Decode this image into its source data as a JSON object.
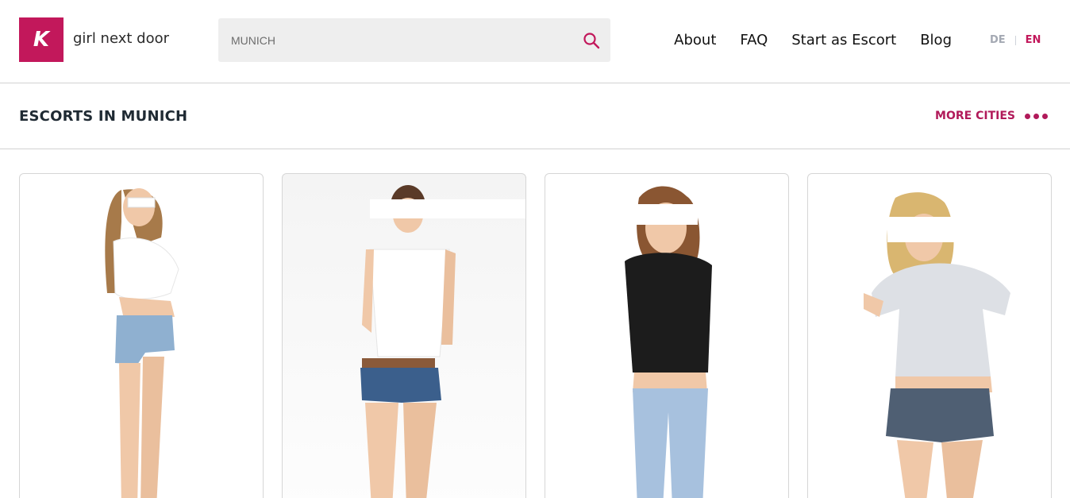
{
  "header": {
    "logo_letter": "K",
    "brand": "girl next door",
    "search_value": "MUNICH",
    "nav": [
      "About",
      "FAQ",
      "Start as Escort",
      "Blog"
    ],
    "lang": {
      "de": "DE",
      "en": "EN",
      "active": "EN"
    }
  },
  "section": {
    "title": "ESCORTS IN MUNICH",
    "more_cities": "MORE CITIES"
  },
  "colors": {
    "accent": "#c2185b",
    "accent_text": "#b11a5a",
    "search_bg": "#eeeeee",
    "divider": "#d2d2d2"
  },
  "icons": {
    "search": "search-icon",
    "more": "dots-icon"
  },
  "cards": [
    {
      "image": "model photo",
      "tee": "#ffffff",
      "bottom": "#8fb0d0"
    },
    {
      "image": "model photo",
      "tee": "#ffffff",
      "bottom": "#3b5f8c"
    },
    {
      "image": "model photo",
      "tee": "#1c1c1c",
      "bottom": "#a7c1de"
    },
    {
      "image": "model photo",
      "tee": "#dde0e5",
      "bottom": "#4f5f73"
    }
  ]
}
